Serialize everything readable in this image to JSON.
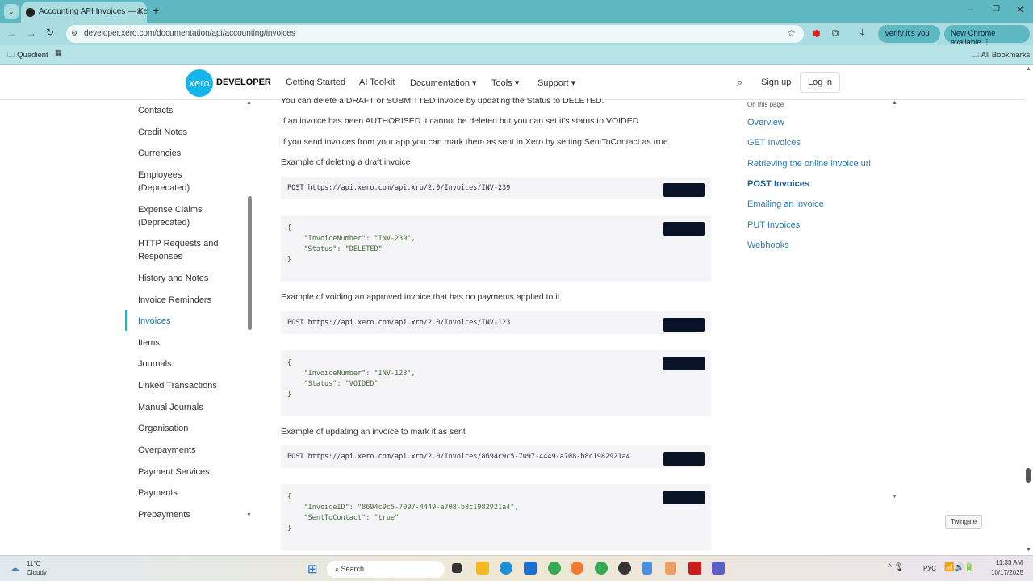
{
  "browser": {
    "tab_title": "Accounting API Invoices — Xero",
    "url": "developer.xero.com/documentation/api/accounting/invoices",
    "verify": "Verify it's you",
    "update": "New Chrome available",
    "bookmark": "Quadient",
    "all_bookmarks": "All Bookmarks"
  },
  "header": {
    "logo": "xero",
    "brand": "DEVELOPER",
    "nav": [
      "Getting Started",
      "AI Toolkit",
      "Documentation",
      "Tools",
      "Support"
    ],
    "signup": "Sign up",
    "login": "Log in"
  },
  "sidebar": {
    "items": [
      "Contacts",
      "Credit Notes",
      "Currencies",
      "Employees (Deprecated)",
      "Expense Claims (Deprecated)",
      "HTTP Requests and Responses",
      "History and Notes",
      "Invoice Reminders",
      "Invoices",
      "Items",
      "Journals",
      "Linked Transactions",
      "Manual Journals",
      "Organisation",
      "Overpayments",
      "Payment Services",
      "Payments",
      "Prepayments"
    ],
    "active": "Invoices"
  },
  "content": {
    "p0": "You can delete a DRAFT or SUBMITTED invoice by updating the Status to DELETED.",
    "p1": "If an invoice has been AUTHORISED it cannot be deleted but you can set it's status to VOIDED",
    "p2": "If you send invoices from your app you can mark them as sent in Xero by setting SentToContact as true",
    "ex1": "Example of deleting a draft invoice",
    "code1": "POST https://api.xero.com/api.xro/2.0/Invoices/INV-239",
    "json1": "{\n    \"InvoiceNumber\": \"INV-239\",\n    \"Status\": \"DELETED\"\n}",
    "ex2": "Example of voiding an approved invoice that has no payments applied to it",
    "code2": "POST https://api.xero.com/api.xro/2.0/Invoices/INV-123",
    "json2": "{\n    \"InvoiceNumber\": \"INV-123\",\n    \"Status\": \"VOIDED\"\n}",
    "ex3": "Example of updating an invoice to mark it as sent",
    "code3": "POST https://api.xero.com/api.xro/2.0/Invoices/8694c9c5-7097-4449-a708-b8c1982921a4",
    "json3": "{\n    \"InvoiceID\": \"8694c9c5-7097-4449-a708-b8c1982921a4\",\n    \"SentToContact\": \"true\"\n}"
  },
  "toc": {
    "title": "On this page",
    "items": [
      "Overview",
      "GET Invoices",
      "Retrieving the online invoice url",
      "POST Invoices",
      "Emailing an invoice",
      "PUT Invoices",
      "Webhooks"
    ],
    "active": "POST Invoices"
  },
  "tooltip": "Twingate",
  "taskbar": {
    "temp": "11°C",
    "weather": "Cloudy",
    "search": "Search",
    "lang": "РУС",
    "time": "11:33 AM",
    "date": "10/17/2025"
  },
  "colors": {
    "accent": "#13b5ea",
    "link": "#2a7ab0",
    "chrome": "#5db8c1"
  }
}
